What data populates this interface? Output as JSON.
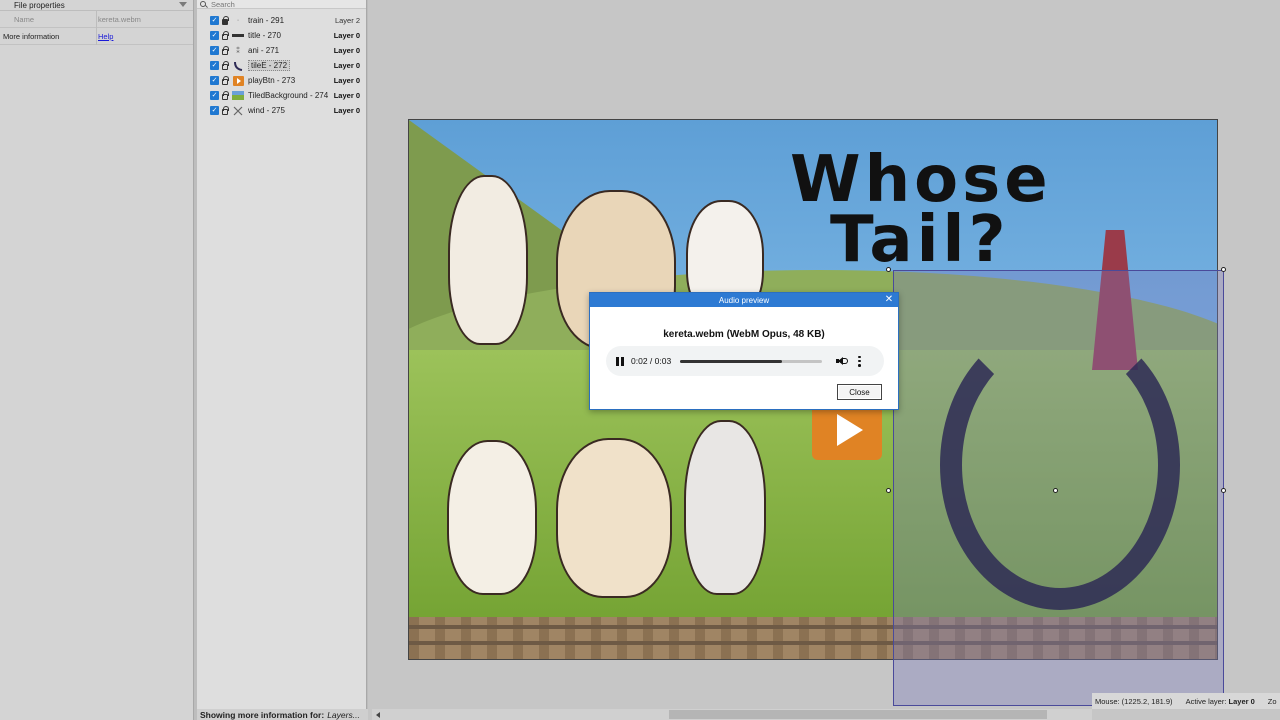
{
  "properties": {
    "header": "File properties",
    "name_label": "Name",
    "name_value": "kereta.webm",
    "info_label": "More information",
    "info_link": "Help"
  },
  "layers": {
    "search_placeholder": "Search",
    "rows": [
      {
        "name": "train - 291",
        "layer": "Layer 2",
        "thumb": "dot-icon"
      },
      {
        "name": "title - 270",
        "layer": "Layer 0",
        "thumb": "title-thumbnail-icon"
      },
      {
        "name": "ani - 271",
        "layer": "Layer 0",
        "thumb": "animation-thumbnail-icon"
      },
      {
        "name": "tileE - 272",
        "layer": "Layer 0",
        "thumb": "tail-thumbnail-icon"
      },
      {
        "name": "playBtn - 273",
        "layer": "Layer 0",
        "thumb": "play-thumbnail-icon"
      },
      {
        "name": "TiledBackground - 274",
        "layer": "Layer 0",
        "thumb": "background-thumbnail-icon"
      },
      {
        "name": "wind - 275",
        "layer": "Layer 0",
        "thumb": "cross-thumbnail-icon"
      }
    ],
    "footer_label": "Showing more information for:",
    "footer_value": "Layers..."
  },
  "canvas": {
    "title_line1": "Whose",
    "title_line2": "Tail?"
  },
  "dialog": {
    "title": "Audio preview",
    "file_info": "kereta.webm (WebM Opus, 48 KB)",
    "time": "0:02 / 0:03",
    "progress": 0.72,
    "close_label": "Close"
  },
  "status": {
    "mouse_label": "Mouse: (1225.2, 181.9)",
    "active_layer_label": "Active layer:",
    "active_layer_value": "Layer 0",
    "zoom_label": "Zo"
  },
  "colors": {
    "accent": "#2d7ad3",
    "checkbox": "#1f78d1"
  }
}
